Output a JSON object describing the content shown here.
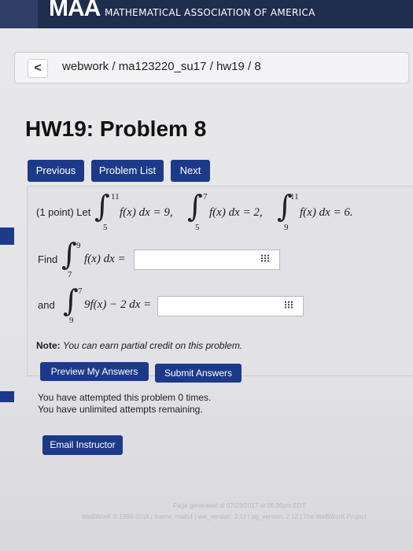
{
  "banner": {
    "logo": "MAA",
    "title": "MATHEMATICAL ASSOCIATION OF AMERICA"
  },
  "breadcrumb": {
    "back": "<",
    "path": "webwork / ma123220_su17 / hw19 / 8"
  },
  "page_title": "HW19: Problem 8",
  "nav": {
    "previous": "Previous",
    "problem_list": "Problem List",
    "next": "Next"
  },
  "problem": {
    "points": "(1 point) Let",
    "given": [
      {
        "lower": "5",
        "upper": "11",
        "integrand": "f(x) dx = 9,"
      },
      {
        "lower": "5",
        "upper": "7",
        "integrand": "f(x) dx = 2,"
      },
      {
        "lower": "9",
        "upper": "11",
        "integrand": "f(x) dx = 6."
      }
    ],
    "find_label": "Find",
    "q1": {
      "lower": "7",
      "upper": "9",
      "integrand": "f(x) dx =",
      "value": ""
    },
    "and_label": "and",
    "q2": {
      "lower": "9",
      "upper": "7",
      "integrand": "9f(x) − 2 dx =",
      "value": ""
    }
  },
  "note": {
    "bold": "Note:",
    "text": "You can earn partial credit on this problem."
  },
  "actions": {
    "preview": "Preview My Answers",
    "submit": "Submit Answers"
  },
  "attempts": {
    "line1": "You have attempted this problem 0 times.",
    "line2": "You have unlimited attempts remaining."
  },
  "email_instructor": "Email Instructor",
  "footer": {
    "generated": "Page generated at 07/23/2017 at 06:36pm EDT",
    "copyright": "WeBWorK © 1996-2016 | theme: math4 | ww_version: 2.12 | pg_version: 2.12 | The WeBWorK Project"
  }
}
